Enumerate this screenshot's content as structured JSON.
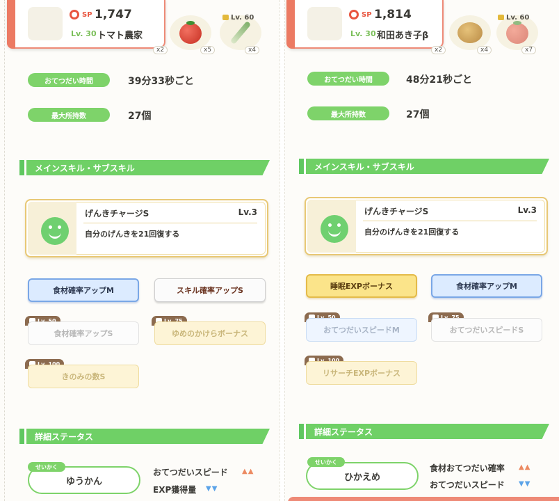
{
  "left": {
    "header": {
      "sp_label": "SP",
      "sp_value": "1,747",
      "level": "Lv. 30",
      "pokemon_name": "トマト農家",
      "badge_main": "x2"
    },
    "ingredients": [
      {
        "name": "tomato-icon",
        "count": "x5",
        "level": ""
      },
      {
        "name": "leek-icon",
        "count": "x4",
        "level": "Lv. 60"
      }
    ],
    "help_time_label": "おてつだい時間",
    "help_time_value": "39分33秒ごと",
    "max_carry_label": "最大所持数",
    "max_carry_value": "27個",
    "section_skill": "メインスキル・サブスキル",
    "main_skill": {
      "name": "げんきチャージS",
      "level": "Lv.3",
      "desc": "自分のげんきを21回復する"
    },
    "sub_skills": [
      {
        "label": "食材確率アップM",
        "unlock": ""
      },
      {
        "label": "スキル確率アップS",
        "unlock": ""
      },
      {
        "label": "食材確率アップS",
        "unlock": "Lv. 50"
      },
      {
        "label": "ゆめのかけらボーナス",
        "unlock": "Lv. 75"
      },
      {
        "label": "きのみの数S",
        "unlock": "Lv. 100"
      }
    ],
    "section_status": "詳細ステータス",
    "nature_tag": "せいかく",
    "nature": "ゆうかん",
    "effects": [
      {
        "label": "おてつだいスピード",
        "dir": "▲▲"
      },
      {
        "label": "EXP獲得量",
        "dir": "▼▼"
      }
    ]
  },
  "right": {
    "header": {
      "sp_label": "SP",
      "sp_value": "1,814",
      "level": "Lv. 30",
      "pokemon_name": "和田あき子β",
      "badge_main": "x2"
    },
    "ingredients": [
      {
        "name": "potato-icon",
        "count": "x4",
        "level": ""
      },
      {
        "name": "tomato-icon",
        "count": "x7",
        "level": "Lv. 60"
      }
    ],
    "help_time_label": "おてつだい時間",
    "help_time_value": "48分21秒ごと",
    "max_carry_label": "最大所持数",
    "max_carry_value": "27個",
    "section_skill": "メインスキル・サブスキル",
    "main_skill": {
      "name": "げんきチャージS",
      "level": "Lv.3",
      "desc": "自分のげんきを21回復する"
    },
    "sub_skills": [
      {
        "label": "睡眠EXPボーナス",
        "unlock": ""
      },
      {
        "label": "食材確率アップM",
        "unlock": ""
      },
      {
        "label": "おてつだいスピードM",
        "unlock": "Lv. 50"
      },
      {
        "label": "おてつだいスピードS",
        "unlock": "Lv. 75"
      },
      {
        "label": "リサーチEXPボーナス",
        "unlock": "Lv. 100"
      }
    ],
    "section_status": "詳細ステータス",
    "nature_tag": "せいかく",
    "nature": "ひかえめ",
    "effects": [
      {
        "label": "食材おてつだい確率",
        "dir": "▲▲"
      },
      {
        "label": "おてつだいスピード",
        "dir": "▼▼"
      }
    ]
  },
  "colors": {
    "accent_green": "#6fd066",
    "sp_red": "#e8553f",
    "header_border": "#ee8a77",
    "up_arrow": "#ec8a62",
    "down_arrow": "#5ba3e8"
  }
}
